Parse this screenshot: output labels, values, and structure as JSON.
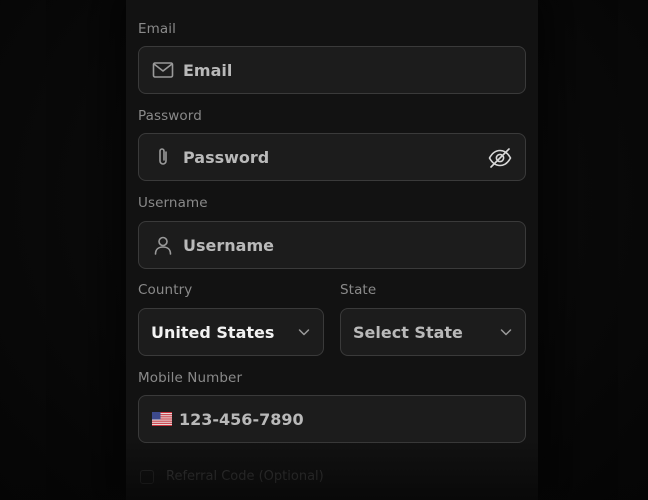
{
  "form": {
    "email": {
      "label": "Email",
      "placeholder": "Email",
      "icon": "mail-icon"
    },
    "password": {
      "label": "Password",
      "placeholder": "Password",
      "icon": "paperclip-icon",
      "toggle_icon": "eye-off-icon"
    },
    "username": {
      "label": "Username",
      "placeholder": "Username",
      "icon": "user-icon"
    },
    "country": {
      "label": "Country",
      "value": "United States",
      "icon": "chevron-down-icon"
    },
    "state": {
      "label": "State",
      "placeholder": "Select State",
      "icon": "chevron-down-icon"
    },
    "mobile": {
      "label": "Mobile Number",
      "value": "123-456-7890",
      "flag": "us-flag-icon"
    },
    "referral": {
      "label": "Referral Code (Optional)"
    }
  },
  "colors": {
    "background": "#050505",
    "card": "#121212",
    "field_bg": "#1c1c1c",
    "field_border": "#3a3a3a",
    "label": "#8a8a8a",
    "placeholder": "#b9b9b9",
    "value": "#f2f2f2"
  }
}
